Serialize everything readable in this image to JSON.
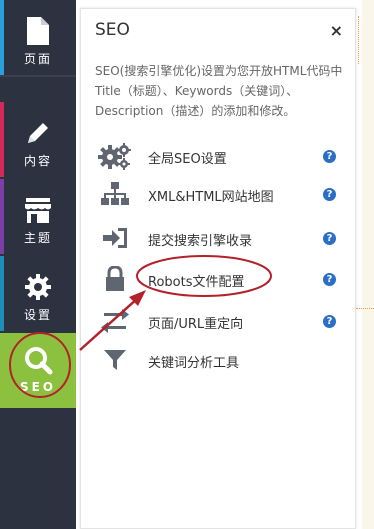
{
  "nav": {
    "items": [
      {
        "label": "页面",
        "icon": "page-icon",
        "stripe": "#2aa0d8"
      },
      {
        "label": "内容",
        "icon": "pencil-icon",
        "stripe": "#d6295b"
      },
      {
        "label": "主题",
        "icon": "store-icon",
        "stripe": "#7b3fa6"
      },
      {
        "label": "设置",
        "icon": "gear-icon",
        "stripe": "#1e90b8"
      },
      {
        "label": "SEO",
        "icon": "search-icon",
        "active": true,
        "color": "#8cc03f"
      }
    ]
  },
  "panel": {
    "title": "SEO",
    "close": "×",
    "description": "SEO(搜索引擎优化)设置为您开放HTML代码中Title（标题）、Keywords（关键词）、Description（描述）的添加和修改。",
    "items": [
      {
        "label": "全局SEO设置",
        "icon": "gears-icon",
        "help": "?"
      },
      {
        "label": "XML&HTML网站地图",
        "icon": "sitemap-icon",
        "help": "?"
      },
      {
        "label": "提交搜索引擎收录",
        "icon": "sign-in-icon",
        "help": "?"
      },
      {
        "label": "Robots文件配置",
        "icon": "lock-icon",
        "help": "?"
      },
      {
        "label": "页面/URL重定向",
        "icon": "redirect-icon",
        "help": "?"
      },
      {
        "label": "关键词分析工具",
        "icon": "filter-icon"
      }
    ]
  },
  "colors": {
    "annotation": "#b3212b",
    "help": "#2b6ec6",
    "nav_bg": "#2d3241"
  }
}
